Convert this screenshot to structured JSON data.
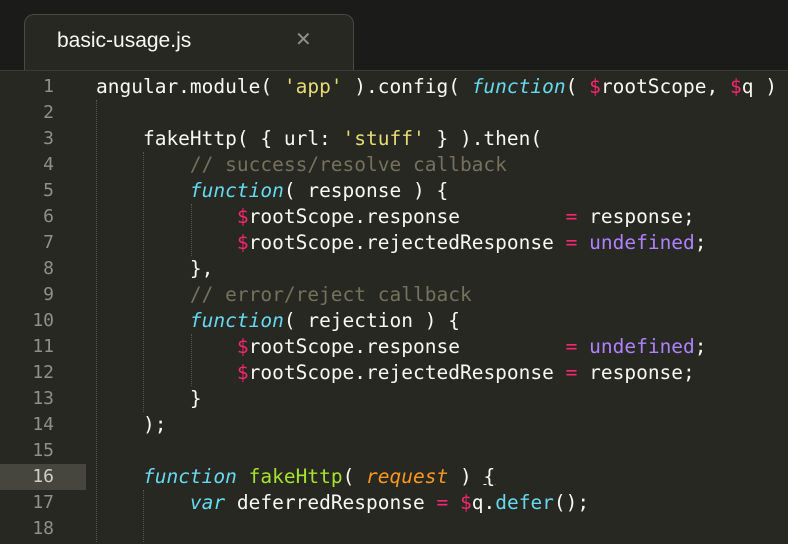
{
  "tab": {
    "title": "basic-usage.js",
    "close_glyph": "✕"
  },
  "theme": {
    "background": "#272822",
    "text": "#f8f8f2",
    "string": "#e6db74",
    "storage": "#66d9ef",
    "keyword": "#f92672",
    "constant": "#ae81ff",
    "function_name": "#a6e22e",
    "parameter": "#fd971f",
    "comment": "#75715e"
  },
  "active_line": 16,
  "lines": [
    {
      "num": "1",
      "tokens": [
        {
          "t": "angular.module( ",
          "k": "plain"
        },
        {
          "t": "'app'",
          "k": "str"
        },
        {
          "t": " ).config( ",
          "k": "plain"
        },
        {
          "t": "function",
          "k": "storage"
        },
        {
          "t": "( ",
          "k": "plain"
        },
        {
          "t": "$",
          "k": "var"
        },
        {
          "t": "rootScope, ",
          "k": "plain"
        },
        {
          "t": "$",
          "k": "var"
        },
        {
          "t": "q )",
          "k": "plain"
        }
      ]
    },
    {
      "num": "2",
      "tokens": []
    },
    {
      "num": "3",
      "tokens": [
        {
          "t": "    fakeHttp( { url: ",
          "k": "plain"
        },
        {
          "t": "'stuff'",
          "k": "str"
        },
        {
          "t": " } ).then(",
          "k": "plain"
        }
      ]
    },
    {
      "num": "4",
      "tokens": [
        {
          "t": "        ",
          "k": "plain"
        },
        {
          "t": "// success/resolve callback",
          "k": "comment"
        }
      ]
    },
    {
      "num": "5",
      "tokens": [
        {
          "t": "        ",
          "k": "plain"
        },
        {
          "t": "function",
          "k": "storage"
        },
        {
          "t": "( response ) {",
          "k": "plain"
        }
      ]
    },
    {
      "num": "6",
      "tokens": [
        {
          "t": "            ",
          "k": "plain"
        },
        {
          "t": "$",
          "k": "var"
        },
        {
          "t": "rootScope.response         ",
          "k": "plain"
        },
        {
          "t": "=",
          "k": "op"
        },
        {
          "t": " response;",
          "k": "plain"
        }
      ]
    },
    {
      "num": "7",
      "tokens": [
        {
          "t": "            ",
          "k": "plain"
        },
        {
          "t": "$",
          "k": "var"
        },
        {
          "t": "rootScope.rejectedResponse ",
          "k": "plain"
        },
        {
          "t": "=",
          "k": "op"
        },
        {
          "t": " ",
          "k": "plain"
        },
        {
          "t": "undefined",
          "k": "const"
        },
        {
          "t": ";",
          "k": "plain"
        }
      ]
    },
    {
      "num": "8",
      "tokens": [
        {
          "t": "        },",
          "k": "plain"
        }
      ]
    },
    {
      "num": "9",
      "tokens": [
        {
          "t": "        ",
          "k": "plain"
        },
        {
          "t": "// error/reject callback",
          "k": "comment"
        }
      ]
    },
    {
      "num": "10",
      "tokens": [
        {
          "t": "        ",
          "k": "plain"
        },
        {
          "t": "function",
          "k": "storage"
        },
        {
          "t": "( rejection ) {",
          "k": "plain"
        }
      ]
    },
    {
      "num": "11",
      "tokens": [
        {
          "t": "            ",
          "k": "plain"
        },
        {
          "t": "$",
          "k": "var"
        },
        {
          "t": "rootScope.response         ",
          "k": "plain"
        },
        {
          "t": "=",
          "k": "op"
        },
        {
          "t": " ",
          "k": "plain"
        },
        {
          "t": "undefined",
          "k": "const"
        },
        {
          "t": ";",
          "k": "plain"
        }
      ]
    },
    {
      "num": "12",
      "tokens": [
        {
          "t": "            ",
          "k": "plain"
        },
        {
          "t": "$",
          "k": "var"
        },
        {
          "t": "rootScope.rejectedResponse ",
          "k": "plain"
        },
        {
          "t": "=",
          "k": "op"
        },
        {
          "t": " response;",
          "k": "plain"
        }
      ]
    },
    {
      "num": "13",
      "tokens": [
        {
          "t": "        }",
          "k": "plain"
        }
      ]
    },
    {
      "num": "14",
      "tokens": [
        {
          "t": "    );",
          "k": "plain"
        }
      ]
    },
    {
      "num": "15",
      "tokens": []
    },
    {
      "num": "16",
      "tokens": [
        {
          "t": "    ",
          "k": "plain"
        },
        {
          "t": "function",
          "k": "storage"
        },
        {
          "t": " ",
          "k": "plain"
        },
        {
          "t": "fakeHttp",
          "k": "func"
        },
        {
          "t": "( ",
          "k": "plain"
        },
        {
          "t": "request",
          "k": "param"
        },
        {
          "t": " ) ",
          "k": "plain"
        },
        {
          "t": "{",
          "k": "bracket"
        }
      ]
    },
    {
      "num": "17",
      "tokens": [
        {
          "t": "        ",
          "k": "plain"
        },
        {
          "t": "var",
          "k": "storage"
        },
        {
          "t": " deferredResponse ",
          "k": "plain"
        },
        {
          "t": "=",
          "k": "op"
        },
        {
          "t": " ",
          "k": "plain"
        },
        {
          "t": "$",
          "k": "var"
        },
        {
          "t": "q.",
          "k": "plain"
        },
        {
          "t": "defer",
          "k": "support"
        },
        {
          "t": "();",
          "k": "plain"
        }
      ]
    },
    {
      "num": "18",
      "tokens": []
    }
  ]
}
